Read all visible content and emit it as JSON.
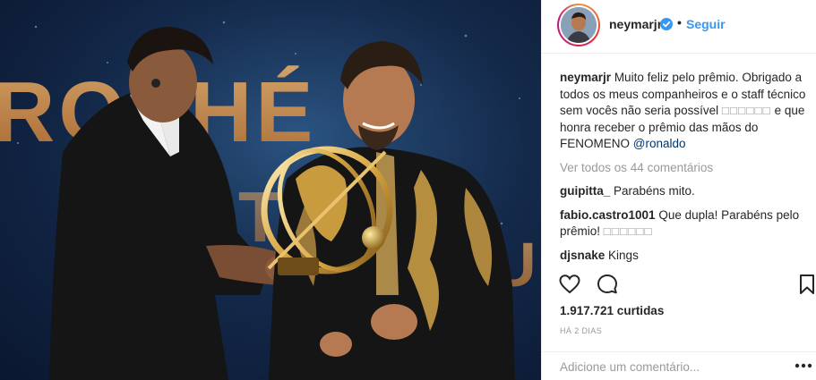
{
  "header": {
    "username": "neymarjr",
    "separator": "•",
    "follow_label": "Seguir",
    "verified_icon": "verified-badge-icon"
  },
  "photo": {
    "backdrop_letters_top": "ROPHÉ",
    "backdrop_letters_bottom": "U TD",
    "backdrop_letter_right": "U"
  },
  "caption": {
    "username": "neymarjr",
    "text_before_emoji": "Muito feliz pelo prêmio. Obrigado a todos os meus companheiros e o staff técnico sem vocês não seria possível",
    "emoji": "□□□□□□",
    "text_after_emoji": "e que honra receber o prêmio das mãos do FENOMENO",
    "mention": "@ronaldo"
  },
  "view_all_comments": "Ver todos os 44 comentários",
  "comments": [
    {
      "username": "guipitta_",
      "text": "Parabéns mito.",
      "emoji": ""
    },
    {
      "username": "fabio.castro1001",
      "text": "Que dupla! Parabéns pelo prêmio!",
      "emoji": "□□□□□□"
    },
    {
      "username": "djsnake",
      "text": "Kings",
      "emoji": ""
    }
  ],
  "actions": {
    "like_icon": "heart-icon",
    "comment_icon": "comment-bubble-icon",
    "save_icon": "bookmark-icon"
  },
  "likes": "1.917.721 curtidas",
  "timestamp": "HÁ 2 DIAS",
  "comment_input": {
    "placeholder": "Adicione um comentário...",
    "more_icon": "more-options-icon"
  },
  "colors": {
    "link_blue": "#3897f0",
    "mention_navy": "#003569",
    "muted_gray": "#999999",
    "text": "#262626",
    "border": "#efefef"
  }
}
